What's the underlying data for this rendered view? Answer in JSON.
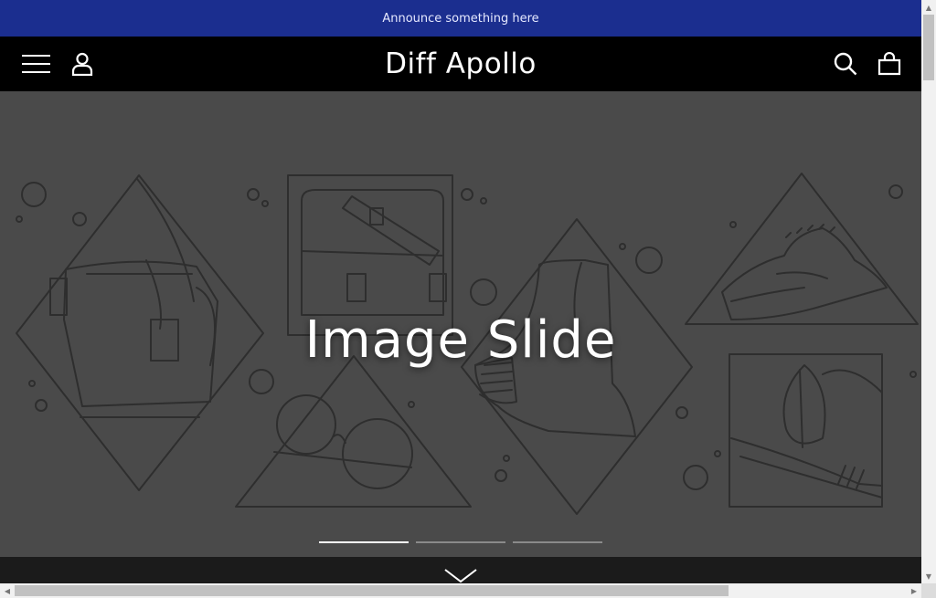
{
  "announcement": {
    "text": "Announce something here"
  },
  "header": {
    "brand": "Diff Apollo",
    "icons": {
      "menu": "hamburger-menu-icon",
      "account": "user-icon",
      "search": "search-icon",
      "cart": "shopping-bag-icon"
    }
  },
  "hero": {
    "title": "Image Slide",
    "slides_count": 3,
    "active_slide": 1
  },
  "colors": {
    "announcement_bg": "#1b2e8f",
    "header_bg": "#000000",
    "hero_bg": "#4a4a4a",
    "line_art": "#2e2e2e"
  }
}
